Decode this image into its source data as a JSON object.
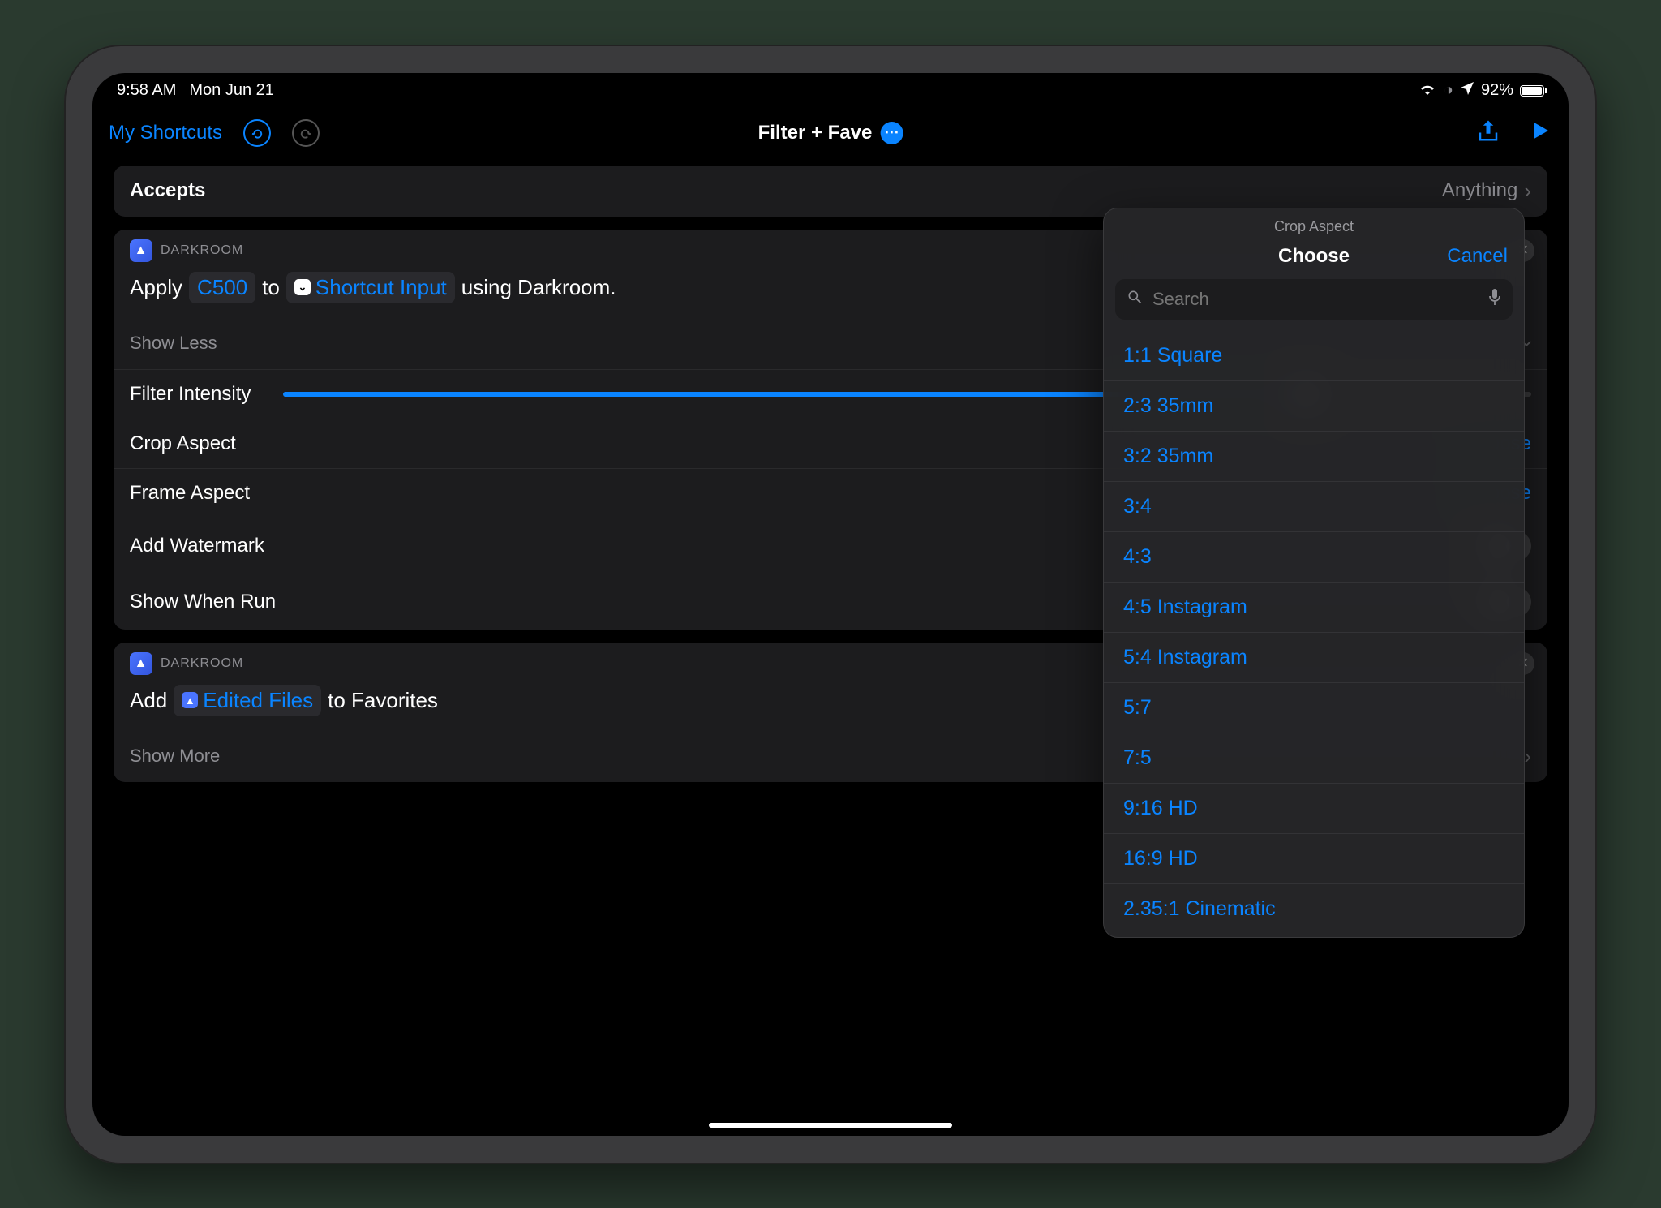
{
  "statusbar": {
    "time": "9:58 AM",
    "date": "Mon Jun 21",
    "battery": "92%"
  },
  "toolbar": {
    "back": "My Shortcuts",
    "title": "Filter + Fave"
  },
  "accepts": {
    "label": "Accepts",
    "value": "Anything"
  },
  "action1": {
    "app": "DARKROOM",
    "verb": "Apply",
    "filter": "C500",
    "to": "to",
    "input": "Shortcut Input",
    "using": "using Darkroom.",
    "showless": "Show Less",
    "rows": {
      "intensity": "Filter Intensity",
      "crop": "Crop Aspect",
      "crop_val": "Choose",
      "frame": "Frame Aspect",
      "frame_val": "Choose",
      "watermark": "Add Watermark",
      "showrun": "Show When Run"
    }
  },
  "action2": {
    "app": "DARKROOM",
    "verb": "Add",
    "files": "Edited Files",
    "to": "to Favorites",
    "showmore": "Show More"
  },
  "popover": {
    "title": "Crop Aspect",
    "choose": "Choose",
    "cancel": "Cancel",
    "search": "Search",
    "options": [
      "1:1 Square",
      "2:3 35mm",
      "3:2 35mm",
      "3:4",
      "4:3",
      "4:5 Instagram",
      "5:4 Instagram",
      "5:7",
      "7:5",
      "9:16 HD",
      "16:9 HD",
      "2.35:1 Cinematic"
    ]
  }
}
